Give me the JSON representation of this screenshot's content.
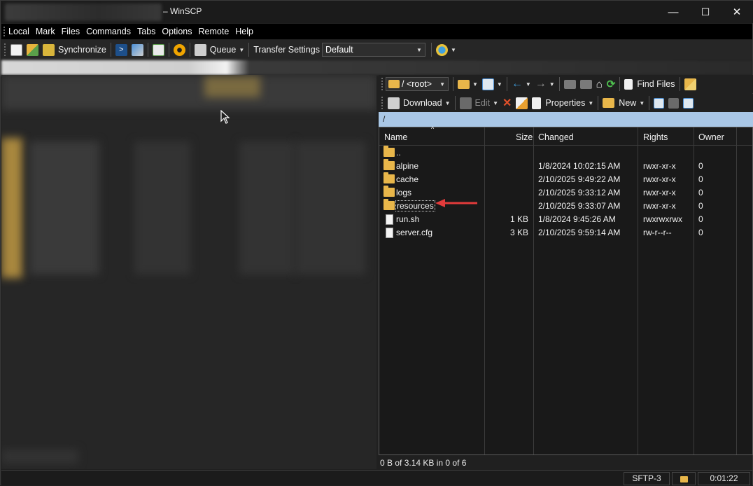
{
  "window": {
    "title_suffix": "– WinSCP",
    "controls": {
      "minimize": "—",
      "maximize": "☐",
      "close": "✕"
    }
  },
  "menu": [
    "Local",
    "Mark",
    "Files",
    "Commands",
    "Tabs",
    "Options",
    "Remote",
    "Help"
  ],
  "toolbar": {
    "synchronize": "Synchronize",
    "queue": "Queue",
    "transfer_settings_label": "Transfer Settings",
    "transfer_settings_value": "Default"
  },
  "remote": {
    "location": "/ <root>",
    "find_files": "Find Files",
    "download": "Download",
    "edit": "Edit",
    "properties": "Properties",
    "new": "New",
    "path": "/",
    "columns": [
      "Name",
      "Size",
      "Changed",
      "Rights",
      "Owner"
    ],
    "files": [
      {
        "name": "..",
        "size": "",
        "changed": "",
        "rights": "",
        "owner": "",
        "type": "parent"
      },
      {
        "name": "alpine",
        "size": "",
        "changed": "1/8/2024 10:02:15 AM",
        "rights": "rwxr-xr-x",
        "owner": "0",
        "type": "folder"
      },
      {
        "name": "cache",
        "size": "",
        "changed": "2/10/2025 9:49:22 AM",
        "rights": "rwxr-xr-x",
        "owner": "0",
        "type": "folder"
      },
      {
        "name": "logs",
        "size": "",
        "changed": "2/10/2025 9:33:12 AM",
        "rights": "rwxr-xr-x",
        "owner": "0",
        "type": "folder"
      },
      {
        "name": "resources",
        "size": "",
        "changed": "2/10/2025 9:33:07 AM",
        "rights": "rwxr-xr-x",
        "owner": "0",
        "type": "folder"
      },
      {
        "name": "run.sh",
        "size": "1 KB",
        "changed": "1/8/2024 9:45:26 AM",
        "rights": "rwxrwxrwx",
        "owner": "0",
        "type": "file"
      },
      {
        "name": "server.cfg",
        "size": "3 KB",
        "changed": "2/10/2025 9:59:14 AM",
        "rights": "rw-r--r--",
        "owner": "0",
        "type": "config"
      }
    ],
    "status": "0 B of 3.14 KB in 0 of 6"
  },
  "statusbar": {
    "protocol": "SFTP-3",
    "elapsed": "0:01:22"
  },
  "colors": {
    "accent_path": "#a9c7e6",
    "folder": "#e8b64a",
    "annotation_arrow": "#e23b3b"
  }
}
